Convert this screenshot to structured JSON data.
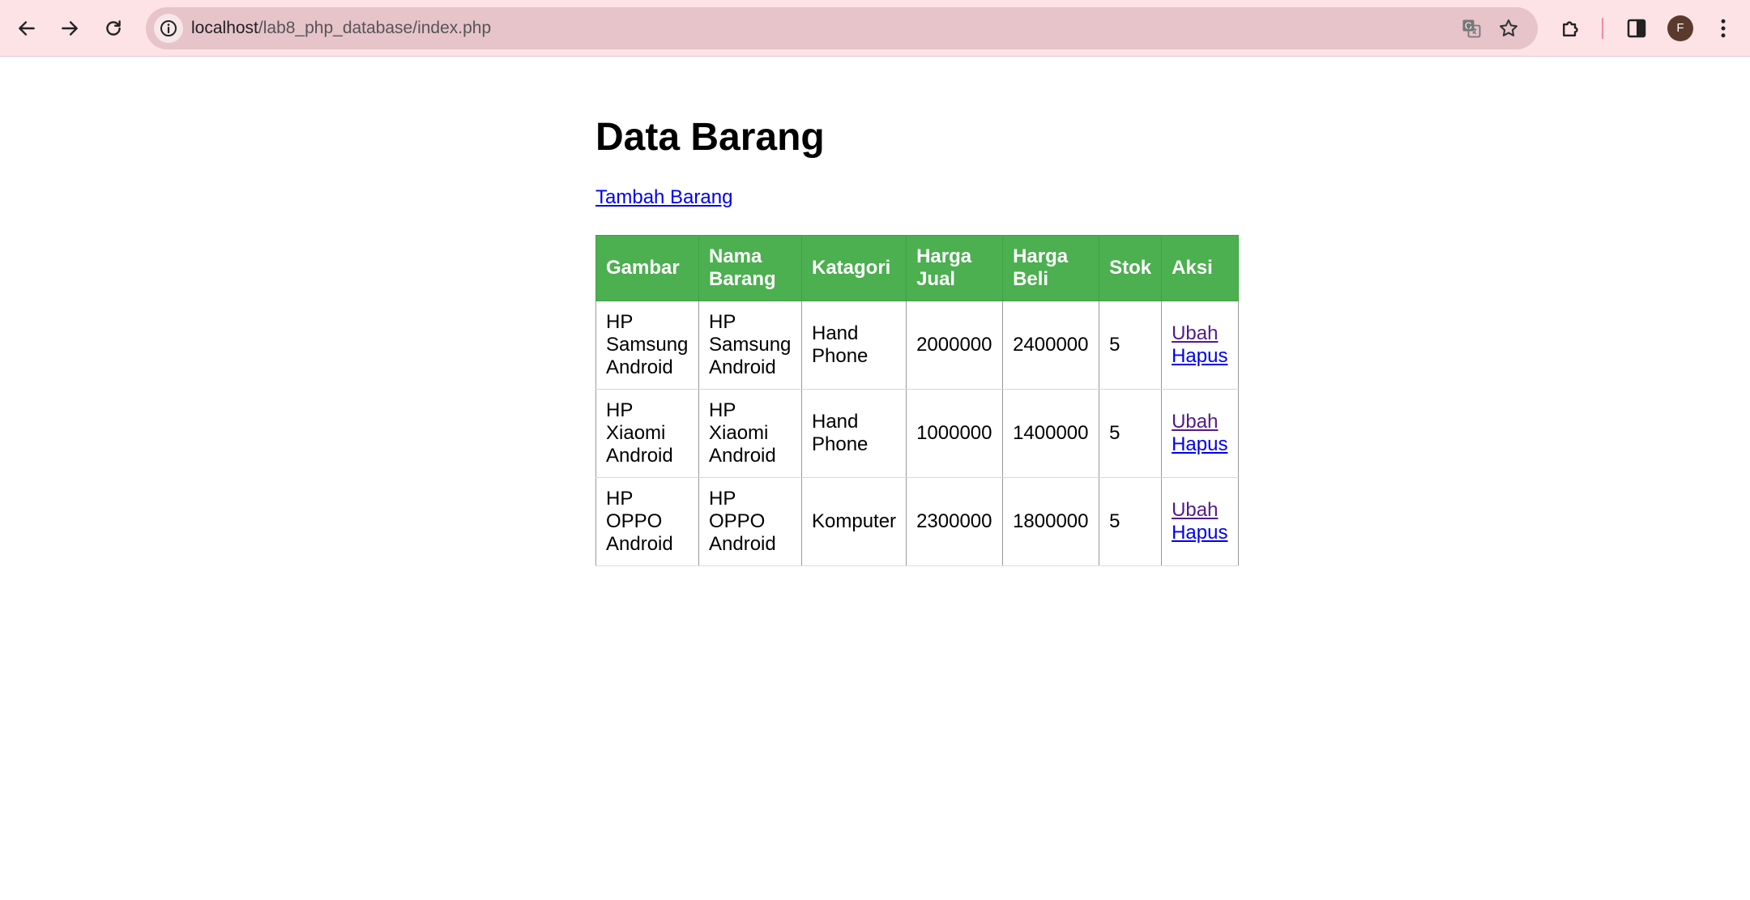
{
  "browser": {
    "url_host": "localhost",
    "url_path": "/lab8_php_database/index.php",
    "profile_initial": "F",
    "colors": {
      "bar_background": "#fde2e6",
      "omnibox_background": "#e6c4ca"
    }
  },
  "page": {
    "title": "Data Barang",
    "add_link_label": "Tambah Barang",
    "table": {
      "header_color": "#4caf50",
      "headers": {
        "gambar": "Gambar",
        "nama": "Nama Barang",
        "katagori": "Katagori",
        "harga_jual": "Harga Jual",
        "harga_beli": "Harga Beli",
        "stok": "Stok",
        "aksi": "Aksi"
      },
      "rows": [
        {
          "gambar": "HP Samsung Android",
          "nama": "HP Samsung Android",
          "katagori": "Hand Phone",
          "harga_jual": "2000000",
          "harga_beli": "2400000",
          "stok": "5",
          "edit_label": "Ubah",
          "delete_label": "Hapus"
        },
        {
          "gambar": "HP Xiaomi Android",
          "nama": "HP Xiaomi Android",
          "katagori": "Hand Phone",
          "harga_jual": "1000000",
          "harga_beli": "1400000",
          "stok": "5",
          "edit_label": "Ubah",
          "delete_label": "Hapus"
        },
        {
          "gambar": "HP OPPO Android",
          "nama": "HP OPPO Android",
          "katagori": "Komputer",
          "harga_jual": "2300000",
          "harga_beli": "1800000",
          "stok": "5",
          "edit_label": "Ubah",
          "delete_label": "Hapus"
        }
      ]
    }
  }
}
